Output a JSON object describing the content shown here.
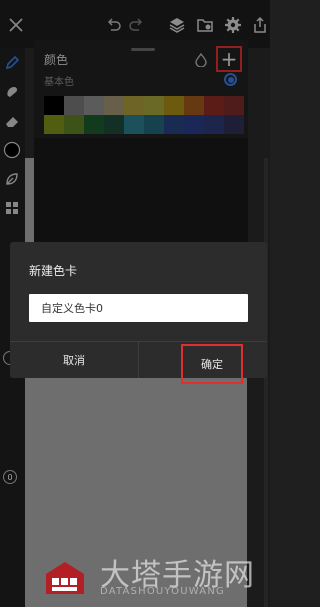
{
  "panel": {
    "title": "颜色",
    "basic_label": "基本色",
    "add_label": "+",
    "swatches": [
      "#000000",
      "#777777",
      "#8c8c8c",
      "#9e9370",
      "#a89a3a",
      "#a3a13b",
      "#a68a16",
      "#9b5a1d",
      "#8d2c25",
      "#7b2a2a",
      "#7d8f1b",
      "#5d7e23",
      "#1d5b2e",
      "#1d4a3b",
      "#2b7c8d",
      "#216679",
      "#27427e",
      "#293c86",
      "#2f3a76",
      "#2f2f55"
    ]
  },
  "dialog": {
    "title": "新建色卡",
    "input_value": "自定义色卡0",
    "cancel_label": "取消",
    "ok_label": "确定"
  },
  "side": {
    "knob_label": "0"
  },
  "watermark": {
    "text": "大塔手游网",
    "subtext": "DATASHOUYOUWANG"
  },
  "colors": {
    "accent_red": "#e0302d",
    "radio_blue": "#3a7de4"
  }
}
